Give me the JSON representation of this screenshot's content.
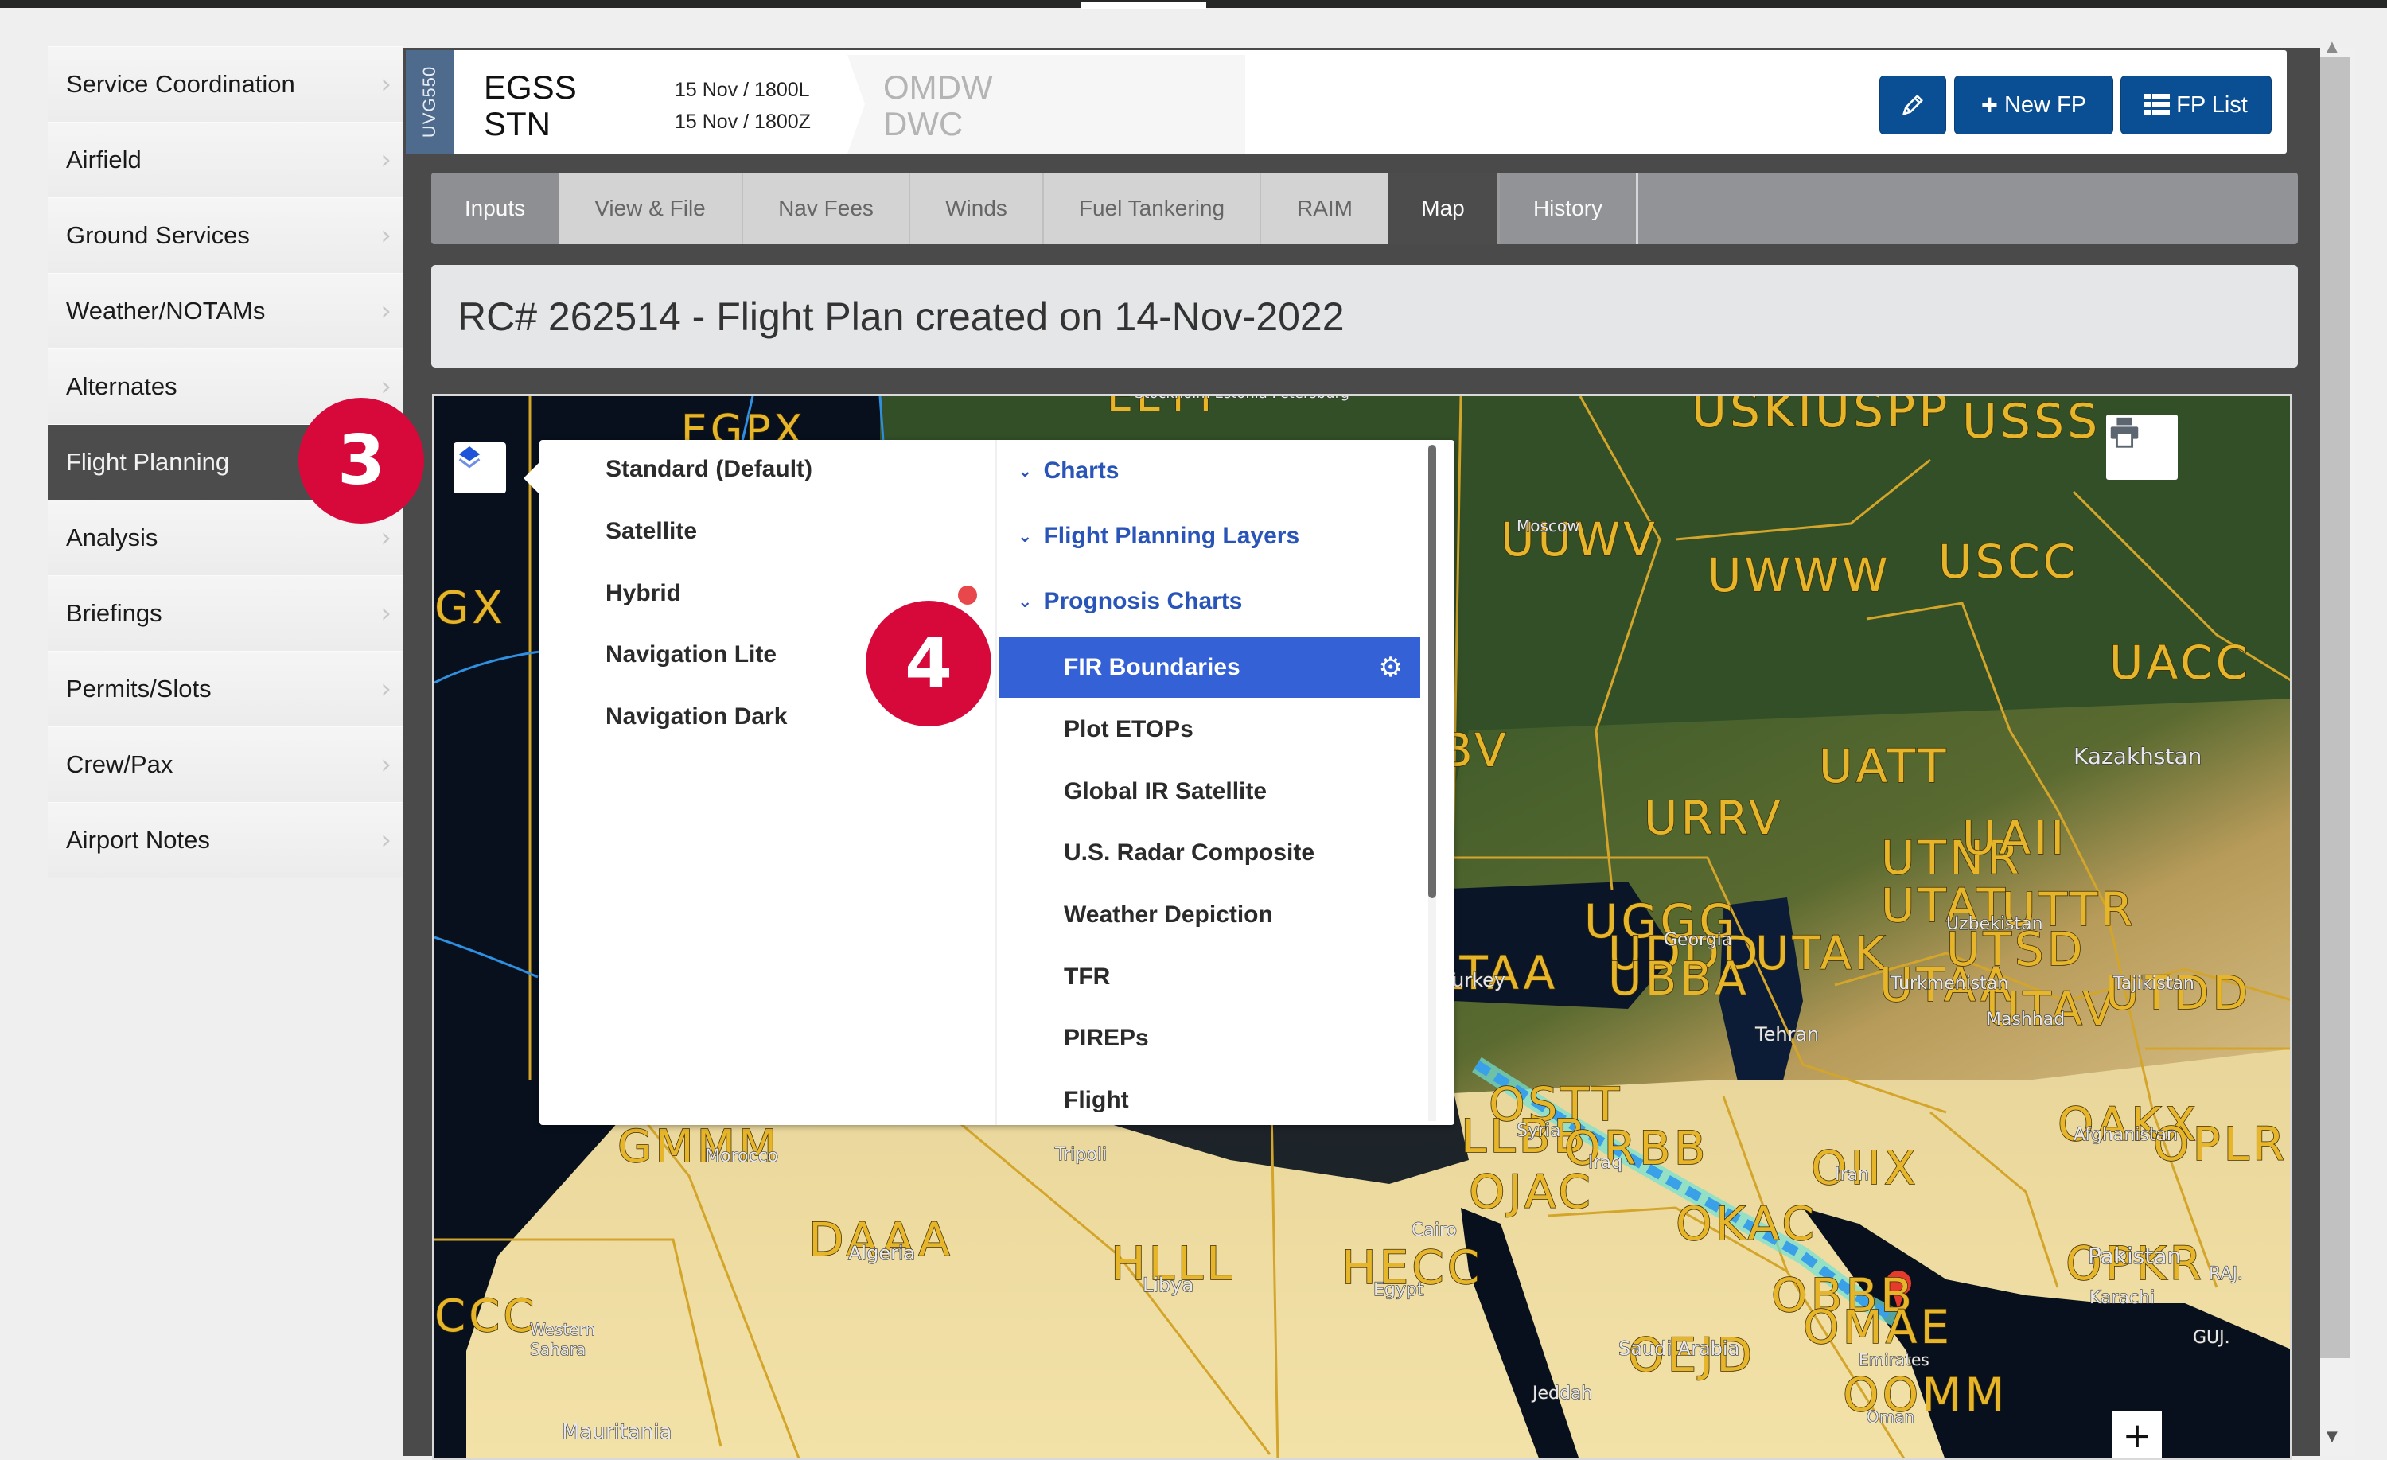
{
  "sidebar": {
    "items": [
      {
        "label": "Service Coordination",
        "active": false
      },
      {
        "label": "Airfield",
        "active": false
      },
      {
        "label": "Ground Services",
        "active": false
      },
      {
        "label": "Weather/NOTAMs",
        "active": false
      },
      {
        "label": "Alternates",
        "active": false
      },
      {
        "label": "Flight Planning",
        "active": true
      },
      {
        "label": "Analysis",
        "active": false
      },
      {
        "label": "Briefings",
        "active": false
      },
      {
        "label": "Permits/Slots",
        "active": false
      },
      {
        "label": "Crew/Pax",
        "active": false
      },
      {
        "label": "Airport Notes",
        "active": false
      }
    ],
    "chevron_icon": "chevron-right-icon"
  },
  "header": {
    "aircraft": "UVG550",
    "departure": {
      "icao": "EGSS",
      "iata": "STN"
    },
    "times": {
      "local": "15 Nov / 1800L",
      "zulu": "15 Nov / 1800Z"
    },
    "destination": {
      "icao": "OMDW",
      "iata": "DWC"
    },
    "buttons": {
      "edit_icon": "pencil-icon",
      "new_fp": "New FP",
      "new_fp_icon": "plus-icon",
      "fp_list": "FP List",
      "fp_list_icon": "list-icon"
    }
  },
  "tabs": [
    {
      "label": "Inputs",
      "state": "default"
    },
    {
      "label": "View & File",
      "state": "disabled"
    },
    {
      "label": "Nav Fees",
      "state": "disabled"
    },
    {
      "label": "Winds",
      "state": "disabled"
    },
    {
      "label": "Fuel Tankering",
      "state": "disabled"
    },
    {
      "label": "RAIM",
      "state": "disabled"
    },
    {
      "label": "Map",
      "state": "active"
    },
    {
      "label": "History",
      "state": "default"
    }
  ],
  "title": "RC# 262514 - Flight Plan created on 14-Nov-2022",
  "map": {
    "layers_icon": "layers-icon",
    "print_icon": "printer-icon",
    "zoom_in_label": "+",
    "fir_labels": [
      "EGPX",
      "EETT",
      "GX",
      "USKIUSPP",
      "USSS",
      "UUWV",
      "UWWW",
      "USCC",
      "UACC",
      "BV",
      "UATT",
      "URRV",
      "UAII",
      "UTNR",
      "UGGG",
      "UTAT",
      "UTTR",
      "UDDD",
      "UTAK",
      "UTSD",
      "LTAA",
      "UBBA",
      "UTAA",
      "UTAV",
      "UTDD",
      "OSTT",
      "LLBB",
      "ORBB",
      "OIIX",
      "OAKX",
      "OPLR",
      "GMMM",
      "DAAA",
      "HLLL",
      "HECC",
      "OJAC",
      "OKAC",
      "OBBB",
      "OMAE",
      "OEJD",
      "OOMM",
      "OPKR",
      "GCCC"
    ],
    "place_labels": [
      "Stockholm",
      "Estonia",
      "Petersburg",
      "Moscow",
      "Kazakhstan",
      "Georgia",
      "Uzbekistan",
      "Turkey",
      "Turkmenistan",
      "Tajikistan",
      "Tehran",
      "Mashhad",
      "Syria",
      "Iraq",
      "Iran",
      "Afghanistan",
      "Pakistan",
      "RAJ.",
      "Karachi",
      "GUJ.",
      "Cairo",
      "Egypt",
      "Saudi Arabia",
      "Jeddah",
      "Emirates",
      "Oman",
      "Algeria",
      "Libya",
      "Tripoli",
      "Morocco",
      "Western Sahara",
      "Mauritania"
    ],
    "route": {
      "from": "EGSS",
      "to": "OMDW",
      "color": "#3aa0e8"
    },
    "destination_marker_color": "#e53b2c"
  },
  "layer_menu": {
    "basemaps": [
      "Standard (Default)",
      "Satellite",
      "Hybrid",
      "Navigation Lite",
      "Navigation Dark"
    ],
    "groups": [
      {
        "label": "Charts",
        "expanded": true
      },
      {
        "label": "Flight Planning Layers",
        "expanded": true
      },
      {
        "label": "Prognosis Charts",
        "expanded": true
      }
    ],
    "overlays": [
      {
        "label": "FIR Boundaries",
        "selected": true,
        "settings_icon": "gear-icon"
      },
      {
        "label": "Plot ETOPs",
        "selected": false
      },
      {
        "label": "Global IR Satellite",
        "selected": false
      },
      {
        "label": "U.S. Radar Composite",
        "selected": false
      },
      {
        "label": "Weather Depiction",
        "selected": false
      },
      {
        "label": "TFR",
        "selected": false
      },
      {
        "label": "PIREPs",
        "selected": false
      },
      {
        "label": "Flight",
        "selected": false
      }
    ],
    "selected_color": "#3461d6",
    "group_color": "#2a55b8"
  },
  "annotations": {
    "step3": "3",
    "step4": "4",
    "color": "#d6093a"
  }
}
